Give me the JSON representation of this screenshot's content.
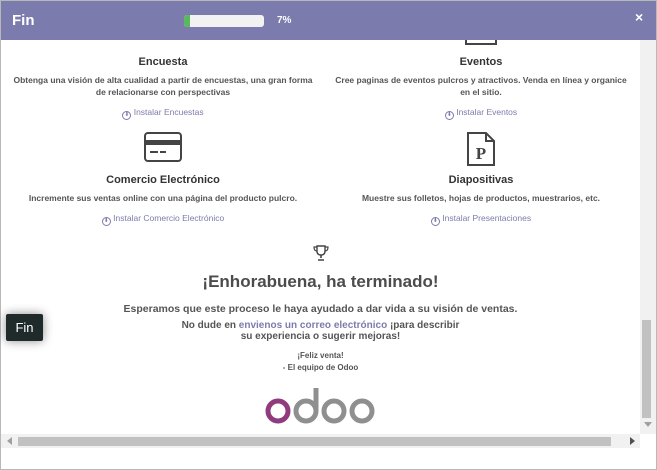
{
  "header": {
    "title": "Fin",
    "progress_text": "7%",
    "progress_value": 0.07,
    "close_symbol": "×"
  },
  "apps": [
    {
      "name": "Encuesta",
      "description": "Obtenga una visión de alta cualidad a partir de encuestas, una gran forma de relacionarse con perspectivas",
      "install": "Instalar Encuestas",
      "icon": "survey-icon"
    },
    {
      "name": "Eventos",
      "description": "Cree paginas de eventos pulcros y atractivos. Venda en línea y organice en el sitio.",
      "install": "Instalar Eventos",
      "icon": "events-icon"
    },
    {
      "name": "Comercio Electrónico",
      "description": "Incremente sus ventas online con una página del producto pulcro.",
      "install": "Instalar Comercio Electrónico",
      "icon": "credit-card-icon"
    },
    {
      "name": "Diapositivas",
      "description": "Muestre sus folletos, hojas de productos, muestrarios, etc.",
      "install": "Instalar Presentaciones",
      "icon": "slides-icon"
    }
  ],
  "finish": {
    "title": "¡Enhorabuena, ha terminado!",
    "hope": "Esperamos que este proceso le haya ayudado a dar vida a su visión de ventas.",
    "contact_prefix": "No dude en ",
    "contact_link": "envienos un correo electrónico",
    "contact_suffix1": " ¡para describir",
    "contact_suffix2": "su experiencia o sugerir mejoras!",
    "sign1": "¡Feliz venta!",
    "sign2": "- El equipo de Odoo",
    "logo": "odoo"
  },
  "tooltip": {
    "text": "Fin"
  },
  "colors": {
    "header": "#7c7bad",
    "accent": "#7c7bad",
    "progress": "#5cb85c",
    "logo_o": "#8f3b7e",
    "logo_gray": "#8f8f8f"
  }
}
